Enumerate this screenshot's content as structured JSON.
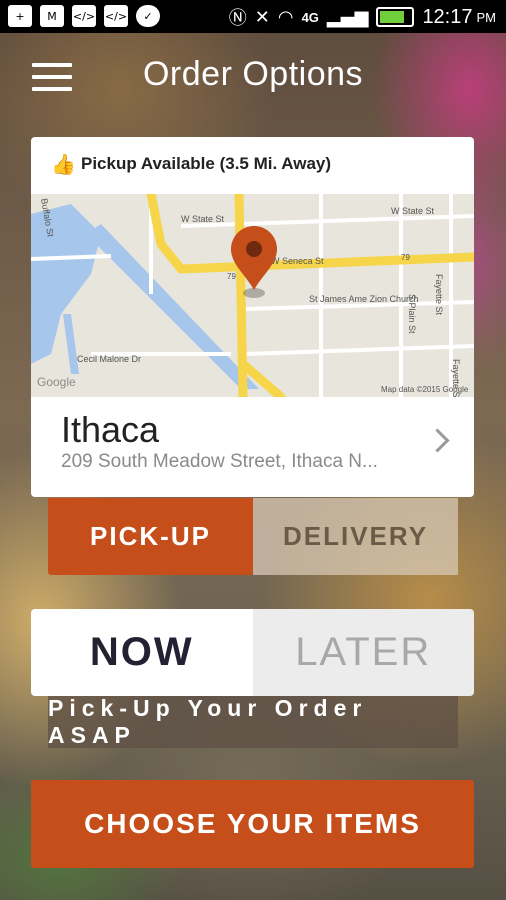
{
  "status_bar": {
    "time": "12:17",
    "ampm": "PM",
    "network": "4G",
    "icons": [
      "add-icon",
      "gmail-icon",
      "code-icon",
      "code-icon",
      "messaging-icon",
      "nfc-icon",
      "mute-icon",
      "wifi-icon",
      "lte-icon",
      "signal-icon",
      "battery-icon"
    ]
  },
  "header": {
    "title": "Order Options",
    "menu_icon": "hamburger-menu-icon"
  },
  "location_card": {
    "availability": "Pickup Available (3.5 Mi. Away)",
    "availability_icon": "thumbs-up-icon",
    "name": "Ithaca",
    "address": "209 South Meadow Street, Ithaca N...",
    "map": {
      "labels": [
        "W State St",
        "W State St",
        "W Seneca St",
        "St James Ame Zion Church",
        "S Plain St",
        "Fayette St",
        "Fayette St",
        "Cecil Malone Dr",
        "Buffalo St",
        "79",
        "79"
      ],
      "attribution": "Map data ©2015 Google",
      "google_logo": "Google",
      "pin_icon": "map-pin-icon"
    },
    "chevron_icon": "chevron-right-icon"
  },
  "fulfillment": {
    "selected": "PICK-UP",
    "options": [
      "PICK-UP",
      "DELIVERY"
    ]
  },
  "timing": {
    "selected": "NOW",
    "options": [
      "NOW",
      "LATER"
    ],
    "note": "Pick-Up Your Order ASAP"
  },
  "cta": {
    "label": "CHOOSE YOUR ITEMS"
  },
  "colors": {
    "accent": "#c54e1a",
    "card_bg": "#ffffff",
    "inactive_text": "#a8a8a8"
  }
}
